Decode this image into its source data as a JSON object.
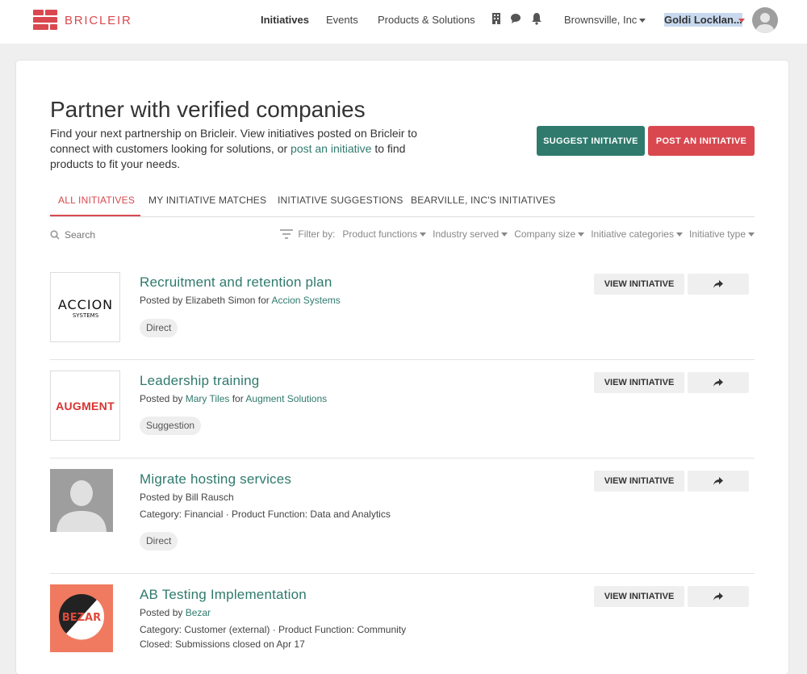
{
  "brand": {
    "name": "BRICLEIR"
  },
  "nav": {
    "links": [
      "Initiatives",
      "Events",
      "Products & Solutions"
    ],
    "company": "Brownsville, Inc",
    "user": "Goldi Locklan..."
  },
  "hero": {
    "title": "Partner with verified companies",
    "intro_before": "Find your next partnership on Bricleir. View initiatives posted on Bricleir to connect with customers looking for solutions, or ",
    "intro_link": "post an initiative",
    "intro_after": " to find products to fit your needs.",
    "suggest_label": "SUGGEST INITIATIVE",
    "post_label": "POST AN INITIATIVE"
  },
  "tabs": [
    "ALL INITIATIVES",
    "MY INITIATIVE MATCHES",
    "INITIATIVE SUGGESTIONS",
    "BEARVILLE, INC'S INITIATIVES"
  ],
  "search": {
    "placeholder": "Search"
  },
  "filters": {
    "label": "Filter by:",
    "options": [
      "Product functions",
      "Industry served",
      "Company size",
      "Initiative categories",
      "Initiative type"
    ]
  },
  "initiatives": [
    {
      "title": "Recruitment and retention plan",
      "posted_prefix": "Posted by Elizabeth Simon for ",
      "posted_link": "Accion Systems",
      "tag": "Direct",
      "logo_text": "ACCION",
      "logo_sub": "SYSTEMS"
    },
    {
      "title": "Leadership training",
      "posted_prefix": "Posted by ",
      "posted_person": "Mary Tiles",
      "posted_mid": " for ",
      "posted_link": "Augment Solutions",
      "tag": "Suggestion",
      "logo_text": "AUGMENT"
    },
    {
      "title": "Migrate hosting services",
      "posted_prefix": "Posted by Bill Rausch",
      "category": "Category: Financial · Product Function: Data and Analytics",
      "tag": "Direct"
    },
    {
      "title": "AB Testing Implementation",
      "posted_prefix": "Posted by ",
      "posted_link": "Bezar",
      "category": "Category: Customer (external) · Product Function: Community",
      "closed": "Closed: Submissions closed on Apr 17",
      "logo_text": "BEZAR"
    }
  ],
  "row_actions": {
    "view_label": "VIEW INITIATIVE"
  },
  "colors": {
    "accent_green": "#2f7a6d",
    "accent_red": "#d9484f"
  },
  "icons": [
    "building-icon",
    "chat-icon",
    "bell-icon",
    "search-icon",
    "filter-icon",
    "share-icon",
    "avatar-icon"
  ]
}
